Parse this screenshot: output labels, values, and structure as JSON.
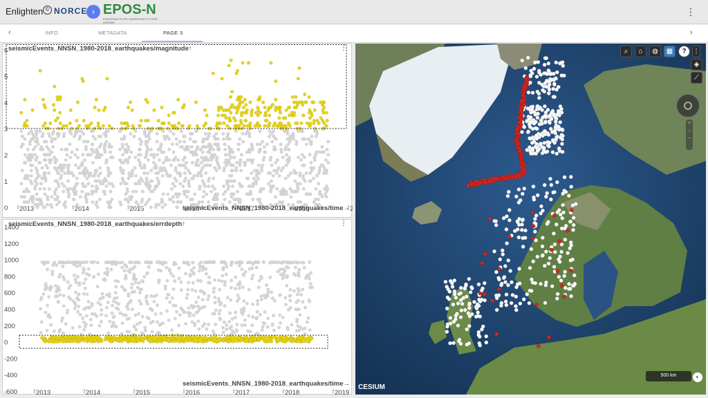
{
  "header": {
    "brand": "Enlighten",
    "partner_logo": "NORCE",
    "epos_logo": "EPOS-N",
    "epos_subtitle": "EUROPEAN PLATE OBSERVING SYSTEM · NORWAY",
    "menu_icon": "kebab-vertical-icon"
  },
  "tabs": [
    {
      "label": "INFO",
      "active": false
    },
    {
      "label": "METADATA",
      "active": false
    },
    {
      "label": "PAGE 3",
      "active": true
    }
  ],
  "chart_data": [
    {
      "type": "scatter",
      "title": "seismicEvents_NNSN_1980-2018_earthquakes/magnitude↑",
      "xlabel": "seismicEvents_NNSN_1980-2018_earthquakes/time→",
      "x_ticks": [
        "2013",
        "2014",
        "2015",
        "2016",
        "2017",
        "2018",
        "2"
      ],
      "y_ticks": [
        "0",
        "1",
        "2",
        "3",
        "4",
        "5",
        "6"
      ],
      "ylim": [
        0,
        6
      ],
      "selection_range": [
        3,
        6.2
      ],
      "selected_color": "#e8d61a",
      "unselected_color": "#d6d6d6"
    },
    {
      "type": "scatter",
      "title": "seismicEvents_NNSN_1980-2018_earthquakes/errdepth↑",
      "xlabel": "seismicEvents_NNSN_1980-2018_earthquakes/time→",
      "x_ticks": [
        "2013",
        "2014",
        "2015",
        "2016",
        "2017",
        "2018",
        "2019"
      ],
      "y_ticks": [
        "-600",
        "-400",
        "-200",
        "0",
        "200",
        "400",
        "600",
        "800",
        "1000",
        "1200",
        "1400"
      ],
      "ylim": [
        -600,
        1400
      ],
      "selection_range": [
        -80,
        80
      ],
      "selected_color": "#e8d61a",
      "unselected_color": "#d6d6d6"
    }
  ],
  "map": {
    "toolbar_icons": [
      "search-icon",
      "home-icon",
      "globe-icon",
      "map-icon",
      "help-icon",
      "kebab-vertical-icon"
    ],
    "side_icons": [
      "layers-icon",
      "chart-icon"
    ],
    "attribution": "CESIUM",
    "scale_label": "500 km",
    "selected_event_color": "#d7261e",
    "event_color": "#ffffff"
  }
}
